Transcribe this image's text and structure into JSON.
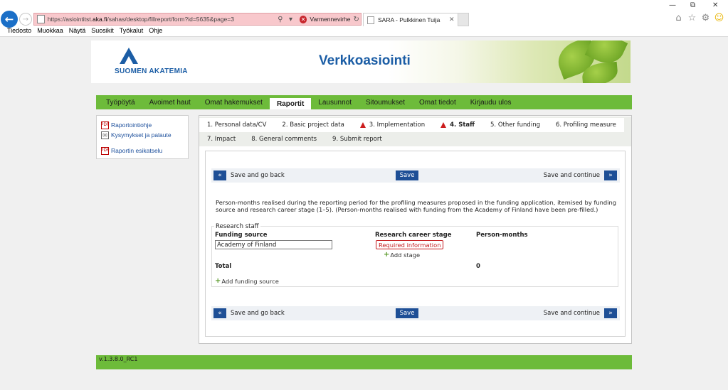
{
  "browser": {
    "url_prefix": "https://asiointitst.",
    "url_domain": "aka.fi",
    "url_rest": "/sahas/desktop/fillreport/form?id=5635&page=3",
    "cert_error": "Varmennevirhe",
    "tab_title": "SARA - Pulkkinen Tuija",
    "menu": [
      "Tiedosto",
      "Muokkaa",
      "Näytä",
      "Suosikit",
      "Työkalut",
      "Ohje"
    ]
  },
  "header": {
    "logo_text": "SUOMEN AKATEMIA",
    "title": "Verkkoasiointi"
  },
  "nav": [
    {
      "label": "Työpöytä",
      "active": false
    },
    {
      "label": "Avoimet haut",
      "active": false
    },
    {
      "label": "Omat hakemukset",
      "active": false
    },
    {
      "label": "Raportit",
      "active": true
    },
    {
      "label": "Lausunnot",
      "active": false
    },
    {
      "label": "Sitoumukset",
      "active": false
    },
    {
      "label": "Omat tiedot",
      "active": false
    },
    {
      "label": "Kirjaudu ulos",
      "active": false
    }
  ],
  "sidebar": [
    {
      "label": "Raportointiohje",
      "icon": "pdf-icon"
    },
    {
      "label": "Kysymykset ja palaute",
      "icon": "mail-icon"
    },
    {
      "label": "Raportin esikatselu",
      "icon": "pdf-icon"
    }
  ],
  "steps_row1": [
    {
      "label": "1. Personal data/CV",
      "warn": false,
      "active": false
    },
    {
      "label": "2. Basic project data",
      "warn": false,
      "active": false
    },
    {
      "label": "3. Implementation",
      "warn": true,
      "active": false
    },
    {
      "label": "4. Staff",
      "warn": true,
      "active": true
    },
    {
      "label": "5. Other funding",
      "warn": false,
      "active": false
    },
    {
      "label": "6. Profiling measure",
      "warn": false,
      "active": false
    }
  ],
  "steps_row2": [
    {
      "label": "7. Impact"
    },
    {
      "label": "8. General comments"
    },
    {
      "label": "9. Submit report"
    }
  ],
  "form": {
    "back_symbol": "«",
    "next_symbol": "»",
    "save_back": "Save and go back",
    "save": "Save",
    "save_continue": "Save and continue",
    "description": "Person-months realised during the reporting period for the profiling measures proposed in the funding application, itemised by funding source and research career stage (1–5). (Person-months realised with funding from the Academy of Finland have been pre-filled.)",
    "section_title": "Research staff",
    "col_funding": "Funding source",
    "col_stage": "Research career stage",
    "col_pm": "Person-months",
    "funding_value": "Academy of Finland",
    "required": "Required information",
    "add_stage": "Add stage",
    "total_label": "Total",
    "total_value": "0",
    "add_funding": "Add funding source"
  },
  "footer": {
    "version": "v.1.3.8.0_RC1"
  },
  "colors": {
    "nav_green": "#6dbb3a",
    "brand_blue": "#1b5da5",
    "button_blue": "#1e4f96",
    "error_red": "#c4181c"
  }
}
